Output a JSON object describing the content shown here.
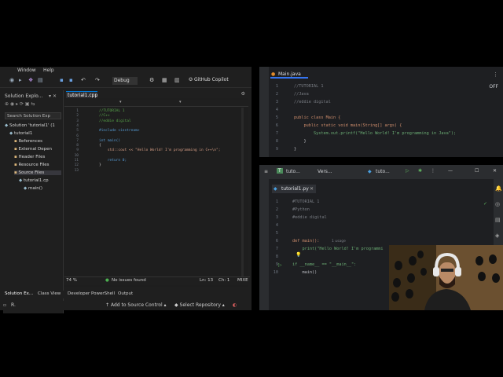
{
  "vs": {
    "menu": [
      "Window",
      "Help"
    ],
    "config": "Debug",
    "copilot": "GitHub Copilot",
    "solution_explorer": {
      "title": "Solution Explo...",
      "search_placeholder": "Search Solution Exp",
      "tree": [
        {
          "label": "Solution 'tutorial1' (1",
          "indent": 0
        },
        {
          "label": "tutorial1",
          "indent": 1
        },
        {
          "label": "References",
          "indent": 2
        },
        {
          "label": "External Depen",
          "indent": 2
        },
        {
          "label": "Header Files",
          "indent": 2
        },
        {
          "label": "Resource Files",
          "indent": 2
        },
        {
          "label": "Source Files",
          "indent": 2
        },
        {
          "label": "tutorial1.cp",
          "indent": 3
        },
        {
          "label": "main()",
          "indent": 4
        }
      ]
    },
    "editor": {
      "tab": "tutorial1.cpp",
      "lines": [
        "//TUTORIAL 1",
        "//C++",
        "//eddie digital",
        "",
        "#include <iostream>",
        "",
        "int main()",
        "{",
        "    std::cout << \"Hello World! I'm programming in C++\\n\";",
        "",
        "    return 0;",
        "}",
        ""
      ]
    },
    "status": {
      "zoom": "74 %",
      "issues": "No issues found",
      "line": "Ln: 13",
      "col": "Ch: 1",
      "mode": "MIXE"
    },
    "bottom_tabs": [
      "Solution Ex...",
      "Class View",
      "Developer PowerShell",
      "Output"
    ],
    "bar": {
      "left": "R.",
      "source_control": "Add to Source Control",
      "repo": "Select Repository"
    }
  },
  "java": {
    "tab": "Main.java",
    "badge": "OFF",
    "lines": [
      "//TUTORIAL 1",
      "//Java",
      "//eddie digital",
      "",
      "public class Main {",
      "    public static void main(String[] args) {",
      "        System.out.printf(\"Hello World! I'm programming in Java\");",
      "    }",
      "}"
    ]
  },
  "py": {
    "title_project": "tuto...",
    "title_vcs": "Vers...",
    "title_run": "tuto...",
    "tab": "tutorial1.py",
    "lines": [
      "#TUTORIAL 1",
      "#Python",
      "#eddie digital",
      "",
      "",
      "def main():",
      "    print(\"Hello World! I'm programmi",
      "",
      "if __name__ == \"__main__\":",
      "    main()"
    ],
    "usage_hint": "1 usage"
  }
}
